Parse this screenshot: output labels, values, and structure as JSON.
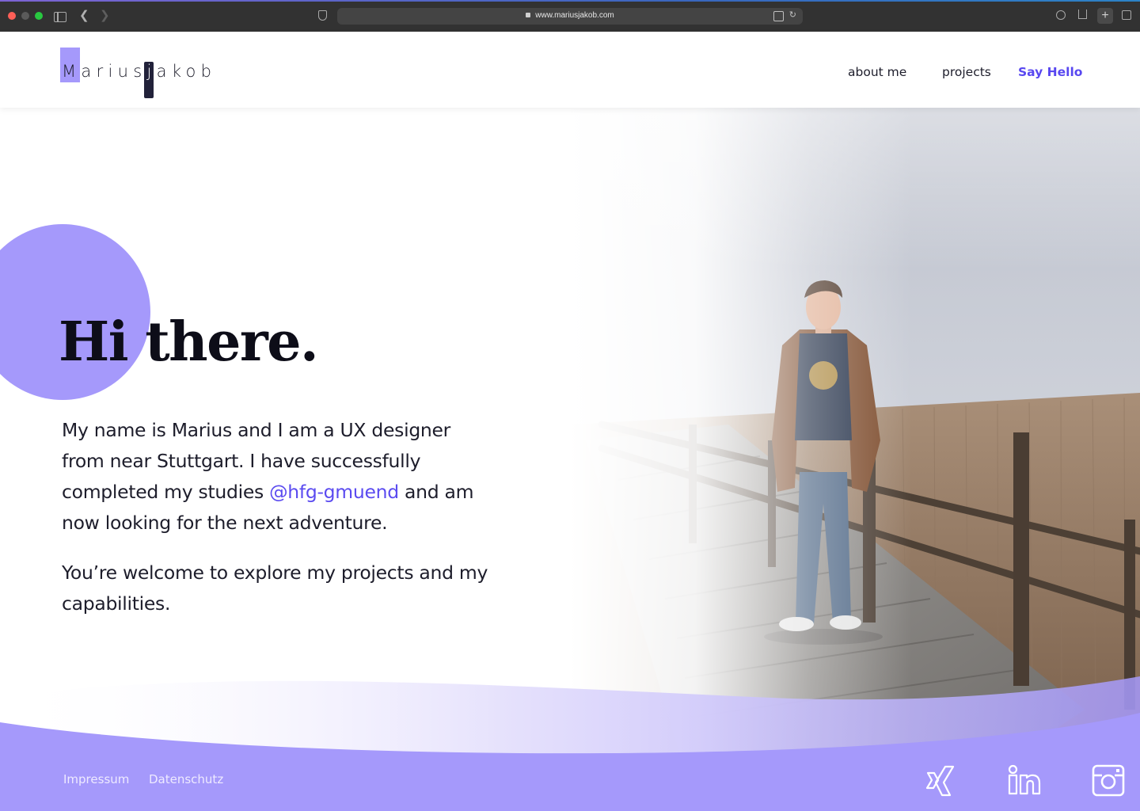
{
  "browser": {
    "url": "www.mariusjakob.com"
  },
  "logo": {
    "first": "Marius",
    "last": "jakob"
  },
  "nav": {
    "about": "about me",
    "projects": "projects",
    "hello": "Say Hello"
  },
  "hero": {
    "title": "Hi there.",
    "intro_before": "My name is Marius and I am a UX designer from near Stuttgart. I have successfully completed my studies ",
    "intro_link": "@hfg-gmuend",
    "intro_after": " and am now looking for the next adventure.",
    "intro2": "You’re welcome to explore my projects and my capabilities."
  },
  "footer": {
    "impressum": "Impressum",
    "datenschutz": "Datenschutz",
    "social": [
      "xing-icon",
      "linkedin-icon",
      "instagram-icon"
    ]
  },
  "colors": {
    "accent": "#a599fb",
    "link": "#5b4bf0",
    "dark": "#22223a"
  }
}
